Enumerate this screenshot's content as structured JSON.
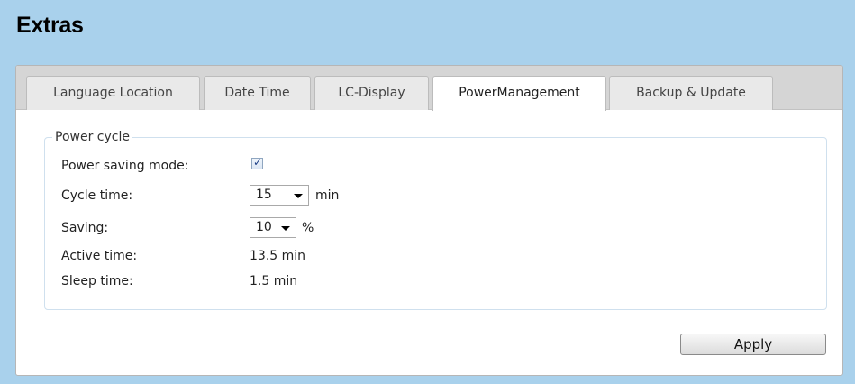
{
  "page": {
    "title": "Extras"
  },
  "tabs": [
    {
      "label": "Language Location",
      "active": false
    },
    {
      "label": "Date Time",
      "active": false
    },
    {
      "label": "LC-Display",
      "active": false
    },
    {
      "label": "PowerManagement",
      "active": true
    },
    {
      "label": "Backup & Update",
      "active": false
    }
  ],
  "power_cycle": {
    "legend": "Power cycle",
    "power_saving_mode": {
      "label": "Power saving mode:",
      "checked": true
    },
    "cycle_time": {
      "label": "Cycle time:",
      "value": "15",
      "unit": "min"
    },
    "saving": {
      "label": "Saving:",
      "value": "10",
      "unit": "%"
    },
    "active_time": {
      "label": "Active time:",
      "value": "13.5 min"
    },
    "sleep_time": {
      "label": "Sleep time:",
      "value": "1.5 min"
    }
  },
  "actions": {
    "apply_label": "Apply"
  },
  "colors": {
    "background": "#a9d1ec",
    "panel": "#ffffff",
    "tabbar": "#d5d5d5"
  }
}
